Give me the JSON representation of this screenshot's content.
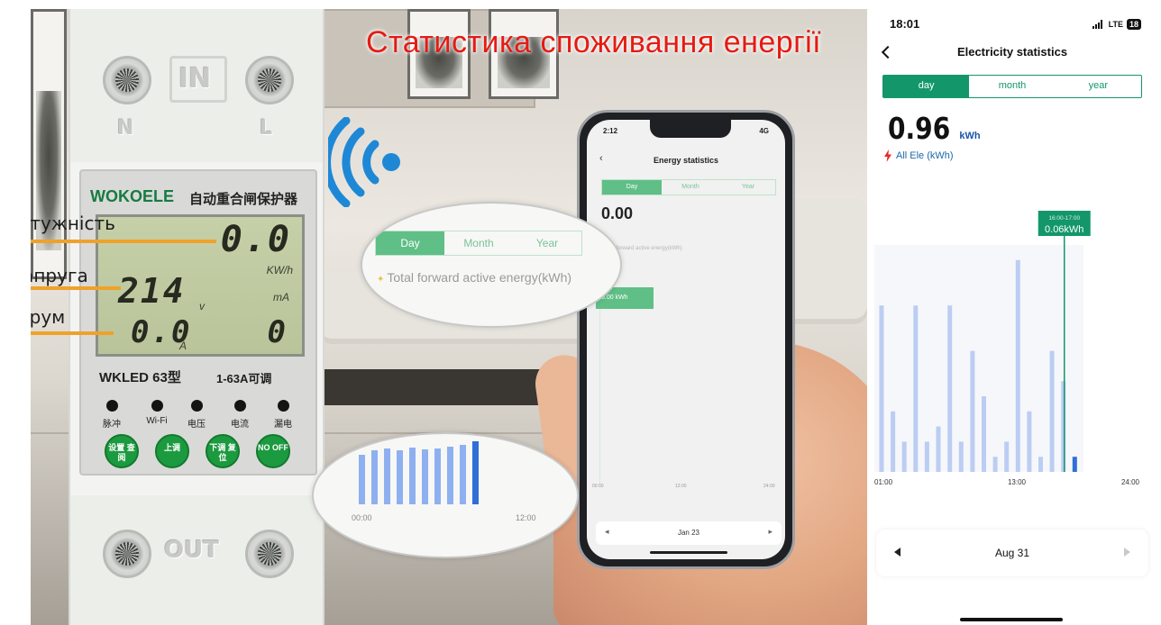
{
  "promo": {
    "title": "Статистика споживання енергії",
    "device": {
      "brand": "WOKOELE",
      "brand_cn": "自动重合闸保护器",
      "terminal_in": "IN",
      "terminal_out": "OUT",
      "terminal_n": "N",
      "terminal_l": "L",
      "lcd": {
        "power_value": "0.0",
        "power_unit": "KW/h",
        "voltage_value": "214",
        "voltage_unit": "v",
        "current_value": "0.0",
        "current_unit": "A",
        "leak_value": "0",
        "leak_unit": "mA"
      },
      "model": "WKLED 63型",
      "range": "1-63A可调",
      "leds": [
        "脉冲",
        "Wi-Fi",
        "电压",
        "电流",
        "漏电"
      ],
      "buttons": [
        "设置 查阅",
        "上调",
        "下调 复位",
        "NO OFF"
      ]
    },
    "annotations": {
      "power": "потужність",
      "voltage": "напруга",
      "current": "струм"
    },
    "bubble_top": {
      "tabs": [
        "Day",
        "Month",
        "Year"
      ],
      "energy_label": "Total forward active energy(kWh)"
    },
    "bubble_bottom": {
      "bars": [
        0.55,
        0.6,
        0.62,
        0.6,
        0.63,
        0.61,
        0.62,
        0.64,
        0.66,
        0.7
      ],
      "ticks": [
        "00:00",
        "12:00"
      ]
    },
    "phone": {
      "time": "2:12",
      "network": "4G",
      "title": "Energy statistics",
      "tabs": [
        "Day",
        "Month",
        "Year"
      ],
      "value": "0.00",
      "energy_label": "Total forward active energy(kWh)",
      "tooltip": "0.00 kWh",
      "x_ticks": [
        "00:00",
        "12:00",
        "24:00"
      ],
      "date": "Jan 23"
    }
  },
  "app": {
    "status": {
      "time": "18:01",
      "network": "LTE",
      "battery": "18"
    },
    "nav": {
      "title": "Electricity statistics"
    },
    "tabs": [
      {
        "label": "day",
        "active": true
      },
      {
        "label": "month",
        "active": false
      },
      {
        "label": "year",
        "active": false
      }
    ],
    "total": {
      "value": "0.96",
      "unit": "kWh"
    },
    "legend": {
      "label": "All Ele (kWh)",
      "color": "#e52a2a"
    },
    "date": "Aug 31",
    "colors": {
      "accent": "#13976a",
      "bar": "#bccdf3",
      "bar_current": "#2f6fd6",
      "value_unit": "#1a56a8"
    }
  },
  "chart_data": {
    "type": "bar",
    "title": "",
    "xlabel": "",
    "ylabel": "",
    "x_tick_labels": [
      "01:00",
      "13:00",
      "24:00"
    ],
    "categories": [
      "01:00",
      "02:00",
      "03:00",
      "04:00",
      "05:00",
      "06:00",
      "07:00",
      "08:00",
      "09:00",
      "10:00",
      "11:00",
      "12:00",
      "13:00",
      "14:00",
      "15:00",
      "16:00",
      "17:00",
      "18:00"
    ],
    "values": [
      0.11,
      0.04,
      0.02,
      0.11,
      0.02,
      0.03,
      0.11,
      0.02,
      0.08,
      0.05,
      0.01,
      0.02,
      0.14,
      0.04,
      0.01,
      0.08,
      0.06,
      0.01
    ],
    "highlight": {
      "index": 16,
      "time_range": "16:00-17:00",
      "value_label": "0.06kWh"
    },
    "ylim": [
      0,
      0.15
    ],
    "grid": false,
    "legend": "none"
  }
}
